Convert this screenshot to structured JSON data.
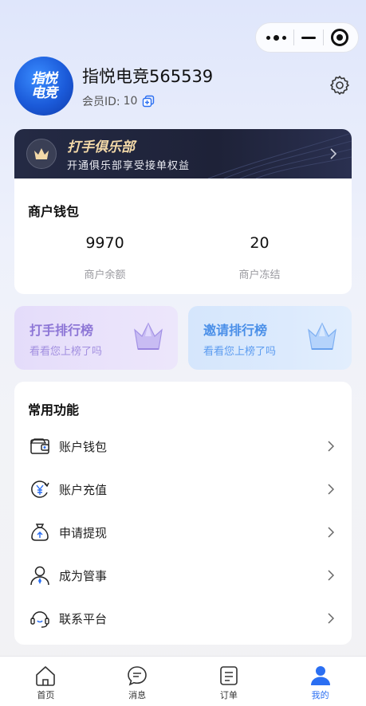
{
  "capsule": {
    "more_icon": "more-dots-icon",
    "minimize_icon": "minimize-icon",
    "close_icon": "close-circle-icon"
  },
  "profile": {
    "avatar_line1": "指悦",
    "avatar_line2": "电竞",
    "username": "指悦电竞565539",
    "member_id_label": "会员ID:",
    "member_id_value": "10"
  },
  "club": {
    "title": "打手俱乐部",
    "subtitle": "开通俱乐部享受接单权益",
    "title_color": "#f3d9a8"
  },
  "wallet": {
    "title": "商户钱包",
    "balance_value": "9970",
    "balance_label": "商户余额",
    "frozen_value": "20",
    "frozen_label": "商户冻结"
  },
  "ranks": [
    {
      "title": "打手排行榜",
      "subtitle": "看看您上榜了吗",
      "color": "#8d76d6"
    },
    {
      "title": "邀请排行榜",
      "subtitle": "看看您上榜了吗",
      "color": "#4a8fe8"
    }
  ],
  "functions": {
    "title": "常用功能",
    "items": [
      {
        "label": "账户钱包",
        "icon": "wallet-icon"
      },
      {
        "label": "账户充值",
        "icon": "recharge-icon"
      },
      {
        "label": "申请提现",
        "icon": "withdraw-bag-icon"
      },
      {
        "label": "成为管事",
        "icon": "user-icon"
      },
      {
        "label": "联系平台",
        "icon": "headset-icon"
      }
    ]
  },
  "tabbar": {
    "items": [
      {
        "label": "首页",
        "icon": "home-icon"
      },
      {
        "label": "消息",
        "icon": "message-icon"
      },
      {
        "label": "订单",
        "icon": "order-icon"
      },
      {
        "label": "我的",
        "icon": "profile-icon"
      }
    ],
    "active_color": "#2b6ff2"
  }
}
